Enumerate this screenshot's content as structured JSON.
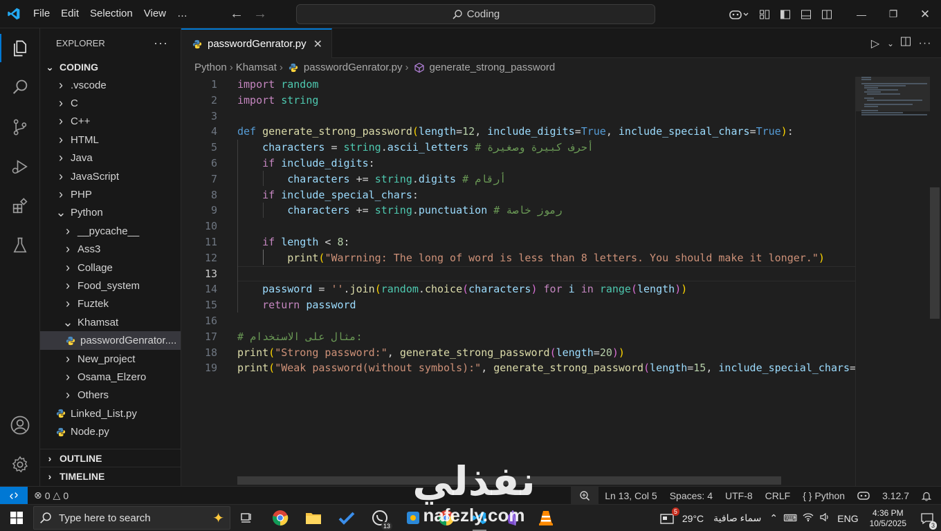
{
  "titlebar": {
    "menus": [
      "File",
      "Edit",
      "Selection",
      "View",
      "…"
    ],
    "search_text": "Coding",
    "window_controls": [
      "minimize-icon",
      "restore-icon",
      "close-icon"
    ]
  },
  "activity_bar": [
    "explorer-icon",
    "search-icon",
    "source-control-icon",
    "run-debug-icon",
    "extensions-icon",
    "testing-icon",
    "account-icon",
    "settings-gear-icon"
  ],
  "sidebar": {
    "title": "EXPLORER",
    "root": "CODING",
    "items": [
      {
        "label": ".vscode",
        "type": "folder",
        "depth": 1,
        "expanded": false
      },
      {
        "label": "C",
        "type": "folder",
        "depth": 1,
        "expanded": false
      },
      {
        "label": "C++",
        "type": "folder",
        "depth": 1,
        "expanded": false
      },
      {
        "label": "HTML",
        "type": "folder",
        "depth": 1,
        "expanded": false
      },
      {
        "label": "Java",
        "type": "folder",
        "depth": 1,
        "expanded": false
      },
      {
        "label": "JavaScript",
        "type": "folder",
        "depth": 1,
        "expanded": false
      },
      {
        "label": "PHP",
        "type": "folder",
        "depth": 1,
        "expanded": false
      },
      {
        "label": "Python",
        "type": "folder",
        "depth": 1,
        "expanded": true
      },
      {
        "label": "__pycache__",
        "type": "folder",
        "depth": 2,
        "expanded": false
      },
      {
        "label": "Ass3",
        "type": "folder",
        "depth": 2,
        "expanded": false
      },
      {
        "label": "Collage",
        "type": "folder",
        "depth": 2,
        "expanded": false
      },
      {
        "label": "Food_system",
        "type": "folder",
        "depth": 2,
        "expanded": false
      },
      {
        "label": "Fuztek",
        "type": "folder",
        "depth": 2,
        "expanded": false
      },
      {
        "label": "Khamsat",
        "type": "folder",
        "depth": 2,
        "expanded": true
      },
      {
        "label": "passwordGenrator....",
        "type": "file",
        "depth": 3,
        "selected": true
      },
      {
        "label": "New_project",
        "type": "folder",
        "depth": 2,
        "expanded": false
      },
      {
        "label": "Osama_Elzero",
        "type": "folder",
        "depth": 2,
        "expanded": false
      },
      {
        "label": "Others",
        "type": "folder",
        "depth": 2,
        "expanded": false
      },
      {
        "label": "Linked_List.py",
        "type": "file",
        "depth": 2
      },
      {
        "label": "Node.py",
        "type": "file",
        "depth": 2
      }
    ],
    "outline": "OUTLINE",
    "timeline": "TIMELINE"
  },
  "tab": {
    "label": "passwordGenrator.py"
  },
  "breadcrumb": [
    "Python",
    "Khamsat",
    "passwordGenrator.py",
    "generate_strong_password"
  ],
  "editor": {
    "line_numbers": [
      "1",
      "2",
      "3",
      "4",
      "5",
      "6",
      "7",
      "8",
      "9",
      "10",
      "11",
      "12",
      "13",
      "14",
      "15",
      "16",
      "17",
      "18",
      "19"
    ],
    "current_line": 13
  },
  "statusbar": {
    "errors": "0",
    "warnings": "0",
    "position": "Ln 13, Col 5",
    "spaces": "Spaces: 4",
    "encoding": "UTF-8",
    "eol": "CRLF",
    "language": "Python",
    "version": "3.12.7"
  },
  "taskbar": {
    "search_placeholder": "Type here to search",
    "whatsapp_badge": "13",
    "weather_temp": "29°C",
    "weather_text": "سماء صافية",
    "notif_badge": "5",
    "lang": "ENG",
    "time": "4:36 PM",
    "date": "10/5/2025",
    "notifications_count": "3"
  },
  "watermark": {
    "big": "نفذلي",
    "small": "nafezly.com"
  },
  "colors": {
    "accent": "#0078d4",
    "keyword": "#c586c0",
    "function": "#dcdcaa",
    "string": "#ce9178",
    "comment": "#6a9955"
  }
}
